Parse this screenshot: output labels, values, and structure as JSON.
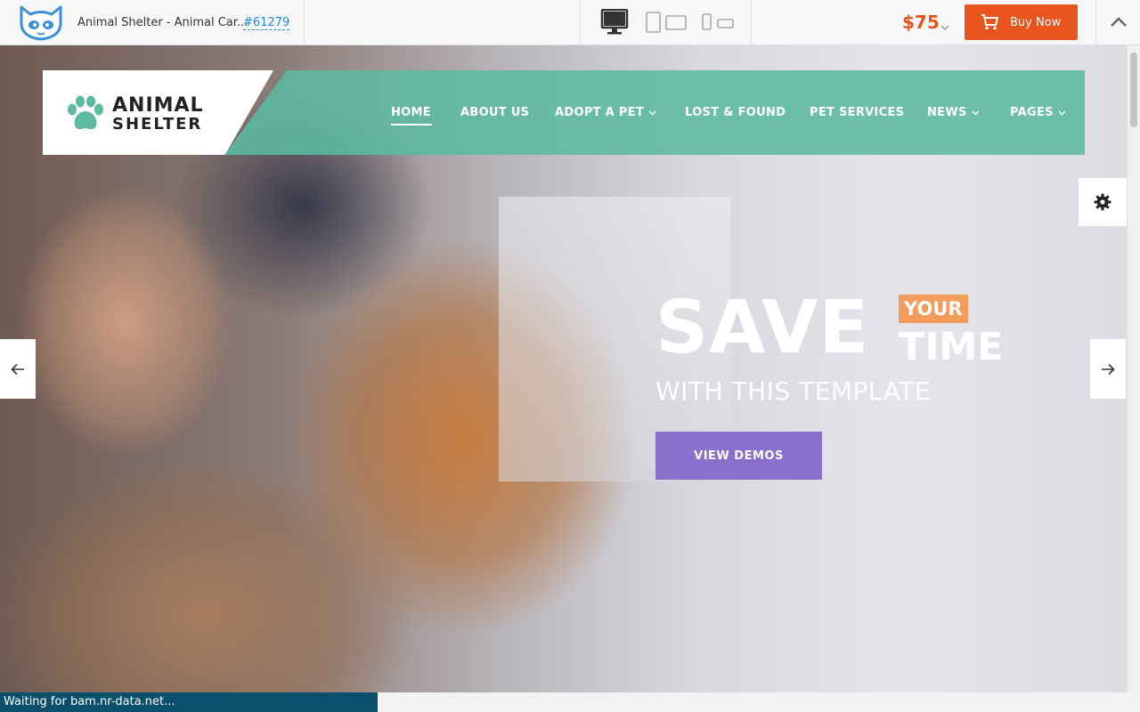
{
  "topbar": {
    "logo_icon": "templatemonster-cat-icon",
    "title": "Animal Shelter - Animal Car...",
    "id_link": "#61279",
    "devices": [
      "desktop-icon",
      "tablet-icon",
      "mobile-icon"
    ],
    "price": "$75",
    "buy_label": "Buy Now",
    "accent_color": "#e8541e"
  },
  "site": {
    "logo_line1": "ANIMAL",
    "logo_line2": "SHELTER",
    "logo_color": "#5cbaa0",
    "nav": [
      {
        "label": "HOME",
        "active": true
      },
      {
        "label": "ABOUT US"
      },
      {
        "label": "ADOPT A PET",
        "dropdown": true
      },
      {
        "label": "LOST & FOUND"
      },
      {
        "label": "PET SERVICES"
      },
      {
        "label": "NEWS",
        "dropdown": true
      },
      {
        "label": "PAGES",
        "dropdown": true
      }
    ]
  },
  "hero": {
    "headline_big": "SAVE",
    "headline_badge": "YOUR",
    "headline_small": "TIME",
    "subtitle": "WITH THIS TEMPLATE",
    "cta_label": "VIEW DEMOS",
    "cta_color": "#8a6fcb",
    "badge_color": "#f49c5a"
  },
  "status": {
    "text": "Waiting for bam.nr-data.net..."
  }
}
